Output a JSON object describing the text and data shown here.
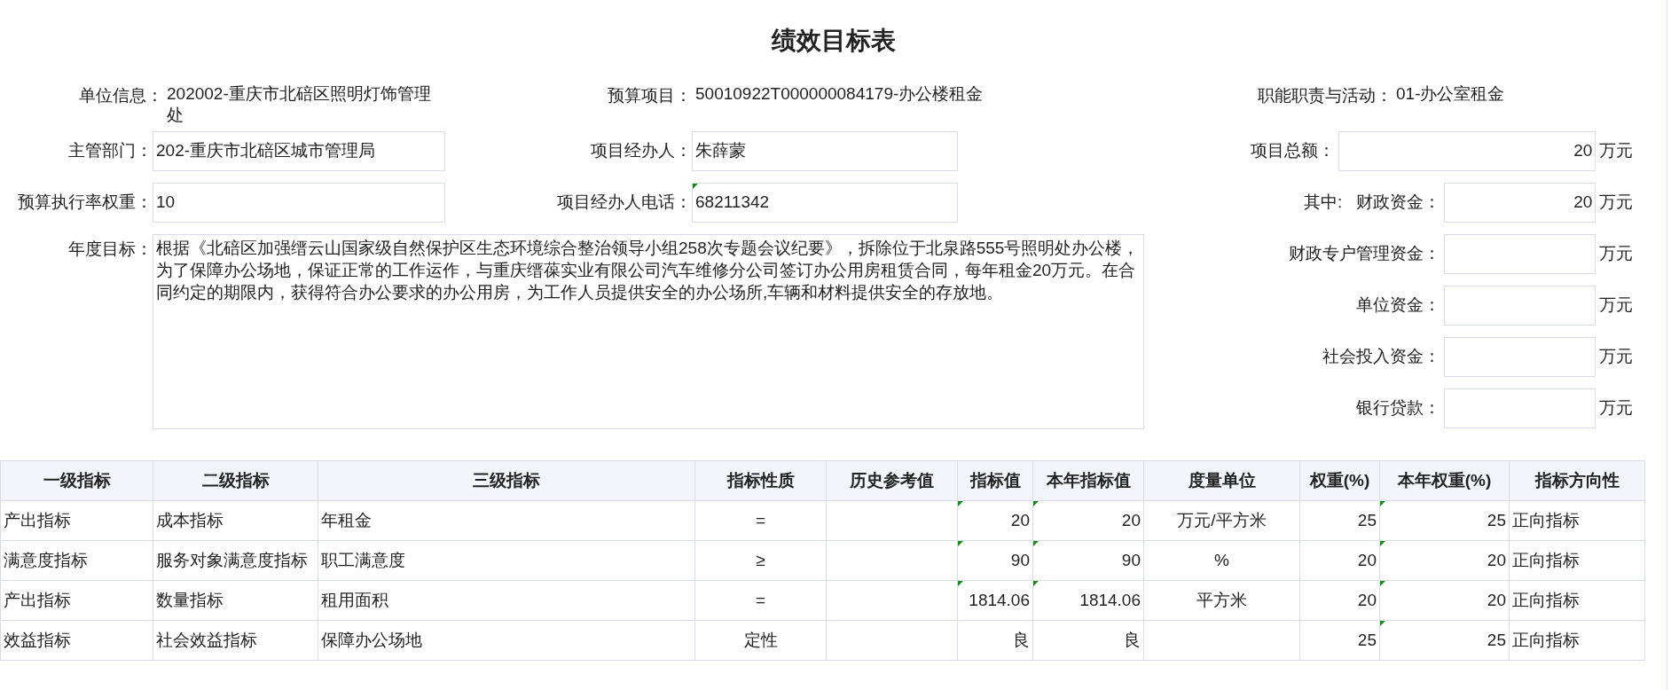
{
  "title": "绩效目标表",
  "info": [
    {
      "label": "单位信息：",
      "value": "202002-重庆市北碚区照明灯饰管理处"
    },
    {
      "label": "预算项目：",
      "value": "50010922T000000084179-办公楼租金"
    },
    {
      "label": "职能职责与活动：",
      "value": "01-办公室租金"
    }
  ],
  "fields": [
    {
      "label": "主管部门：",
      "value": "202-重庆市北碚区城市管理局",
      "flag": false
    },
    {
      "label": "项目经办人：",
      "value": "朱薛蒙",
      "flag": false
    },
    {
      "label": "预算执行率权重：",
      "value": "10",
      "flag": false
    },
    {
      "label": "项目经办人电话：",
      "value": "68211342",
      "flag": true
    }
  ],
  "goal": {
    "label": "年度目标：",
    "value": "根据《北碚区加强缙云山国家级自然保护区生态环境综合整治领导小组258次专题会议纪要》，拆除位于北泉路555号照明处办公楼，为了保障办公场地，保证正常的工作运作，与重庆缙葆实业有限公司汽车维修分公司签订办公用房租赁合同，每年租金20万元。在合同约定的期限内，获得符合办公要求的办公用房，为工作人员提供安全的办公场所,车辆和材料提供安全的存放地。"
  },
  "funds": [
    {
      "kind": "total",
      "label": "项目总额：",
      "value": "20",
      "unit": "万元"
    },
    {
      "kind": "part",
      "prefix": "其中:",
      "label": "财政资金：",
      "value": "20",
      "unit": "万元"
    },
    {
      "kind": "part",
      "label": "财政专户管理资金：",
      "unit": "万元"
    },
    {
      "kind": "part",
      "label": "单位资金：",
      "unit": "万元"
    },
    {
      "kind": "part",
      "label": "社会投入资金：",
      "unit": "万元"
    },
    {
      "kind": "part",
      "label": "银行贷款：",
      "unit": "万元"
    }
  ],
  "table": {
    "columns": [
      "一级指标",
      "二级指标",
      "三级指标",
      "指标性质",
      "历史参考值",
      "指标值",
      "本年指标值",
      "度量单位",
      "权重(%)",
      "本年权重(%)",
      "指标方向性"
    ],
    "rows": [
      {
        "cells": [
          {
            "text": "产出指标",
            "flag": false
          },
          {
            "text": "成本指标",
            "flag": false
          },
          {
            "text": "年租金",
            "flag": false
          },
          {
            "text": "=",
            "flag": false
          },
          {
            "text": "",
            "flag": false
          },
          {
            "text": "20",
            "flag": true
          },
          {
            "text": "20",
            "flag": true
          },
          {
            "text": "万元/平方米",
            "flag": false
          },
          {
            "text": "25",
            "flag": false
          },
          {
            "text": "25",
            "flag": true
          },
          {
            "text": "正向指标",
            "flag": false
          }
        ]
      },
      {
        "cells": [
          {
            "text": "满意度指标",
            "flag": false
          },
          {
            "text": "服务对象满意度指标",
            "flag": false
          },
          {
            "text": "职工满意度",
            "flag": false
          },
          {
            "text": "≥",
            "flag": false
          },
          {
            "text": "",
            "flag": false
          },
          {
            "text": "90",
            "flag": true
          },
          {
            "text": "90",
            "flag": true
          },
          {
            "text": "%",
            "flag": false
          },
          {
            "text": "20",
            "flag": false
          },
          {
            "text": "20",
            "flag": true
          },
          {
            "text": "正向指标",
            "flag": false
          }
        ]
      },
      {
        "cells": [
          {
            "text": "产出指标",
            "flag": false
          },
          {
            "text": "数量指标",
            "flag": false
          },
          {
            "text": "租用面积",
            "flag": false
          },
          {
            "text": "=",
            "flag": false
          },
          {
            "text": "",
            "flag": false
          },
          {
            "text": "1814.06",
            "flag": true
          },
          {
            "text": "1814.06",
            "flag": true
          },
          {
            "text": "平方米",
            "flag": false
          },
          {
            "text": "20",
            "flag": false
          },
          {
            "text": "20",
            "flag": true
          },
          {
            "text": "正向指标",
            "flag": false
          }
        ]
      },
      {
        "cells": [
          {
            "text": "效益指标",
            "flag": false
          },
          {
            "text": "社会效益指标",
            "flag": false
          },
          {
            "text": "保障办公场地",
            "flag": false
          },
          {
            "text": "定性",
            "flag": false
          },
          {
            "text": "",
            "flag": false
          },
          {
            "text": "良",
            "flag": false
          },
          {
            "text": "良",
            "flag": false
          },
          {
            "text": "",
            "flag": false
          },
          {
            "text": "25",
            "flag": false
          },
          {
            "text": "25",
            "flag": true
          },
          {
            "text": "正向指标",
            "flag": false
          }
        ]
      }
    ]
  }
}
